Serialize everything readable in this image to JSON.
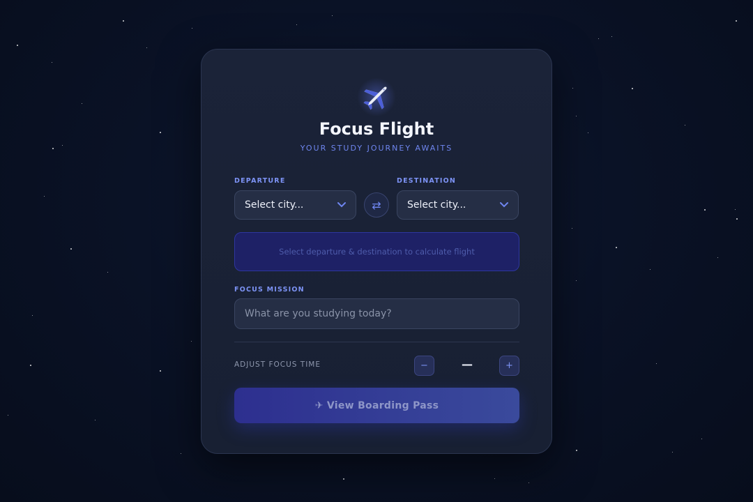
{
  "header": {
    "title": "Focus Flight",
    "subtitle": "YOUR STUDY JOURNEY AWAITS",
    "logo_icon": "airplane-icon"
  },
  "route": {
    "departure_label": "DEPARTURE",
    "departure_value": "Select city...",
    "destination_label": "DESTINATION",
    "destination_value": "Select city...",
    "swap_icon": "swap-arrows-icon",
    "swap_glyph": "⇄",
    "info_message": "Select departure & destination to calculate flight"
  },
  "mission": {
    "label": "FOCUS MISSION",
    "placeholder": "What are you studying today?"
  },
  "focus_time": {
    "label": "ADJUST FOCUS TIME",
    "decrement": "−",
    "increment": "+",
    "value": "—"
  },
  "action": {
    "label": "✈ View Boarding Pass"
  },
  "colors": {
    "accent": "#6f86f0",
    "card_bg": "#1b2338",
    "page_bg": "#0a1226",
    "button_start": "#2d2f8f",
    "button_end": "#3a4a9c"
  }
}
